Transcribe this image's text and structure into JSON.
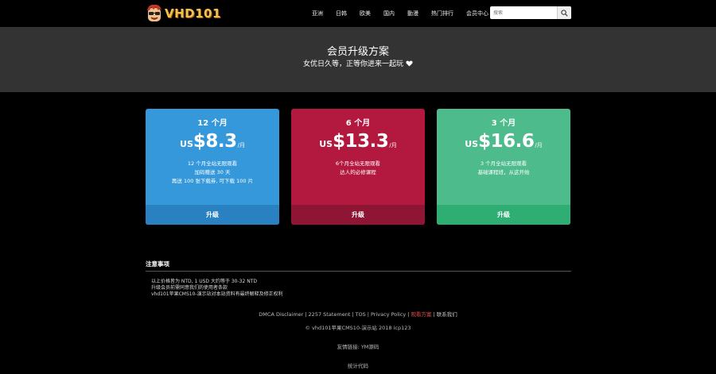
{
  "brand": {
    "name": "VHD101"
  },
  "nav": {
    "items": [
      "亚洲",
      "日韩",
      "欧美",
      "国内",
      "動漫",
      "热门排行",
      "会员中心"
    ]
  },
  "search": {
    "placeholder": "搜索",
    "icon": "search-icon"
  },
  "hero": {
    "title": "会员升级方案",
    "subtitle": "女优日久等，正等你进来一起玩"
  },
  "plans": [
    {
      "period": "12 个月",
      "currency": "US",
      "amount": "$8.3",
      "per": "/月",
      "lines": [
        "12 个月全站无限观看",
        "加码赠送 30 天",
        "再送 100 张下载券, 可下载 100 片"
      ],
      "button": "升级",
      "color": "#3498db"
    },
    {
      "period": "6 个月",
      "currency": "US",
      "amount": "$13.3",
      "per": "/月",
      "lines": [
        "6个月全站无限观看",
        "达人的必修课程"
      ],
      "button": "升级",
      "color": "#b3193f"
    },
    {
      "period": "3 个月",
      "currency": "US",
      "amount": "$16.6",
      "per": "/月",
      "lines": [
        "3 个月全站无限观看",
        "基础课程班，从这开始"
      ],
      "button": "升级",
      "color": "#4dbb8c"
    }
  ],
  "notes": {
    "title": "注意事项",
    "items": [
      "以上价格皆为 NTD, 1 USD 大约等于 30-32 NTD",
      "升级会员前需同意我们的使用者条款",
      "vhd101苹果CMS10-演示站对本站资料有最终解释及修正权利"
    ]
  },
  "footer": {
    "links": [
      "DMCA Disclaimer",
      "2257 Statement",
      "TOS",
      "Privacy Policy",
      "观看方案",
      "联系我们"
    ],
    "highlight_index": 4,
    "copyright": "© vhd101苹果CMS10-演示站 2018 icp123",
    "friend": "友情链接: YM源码",
    "stats": "统计代码"
  }
}
